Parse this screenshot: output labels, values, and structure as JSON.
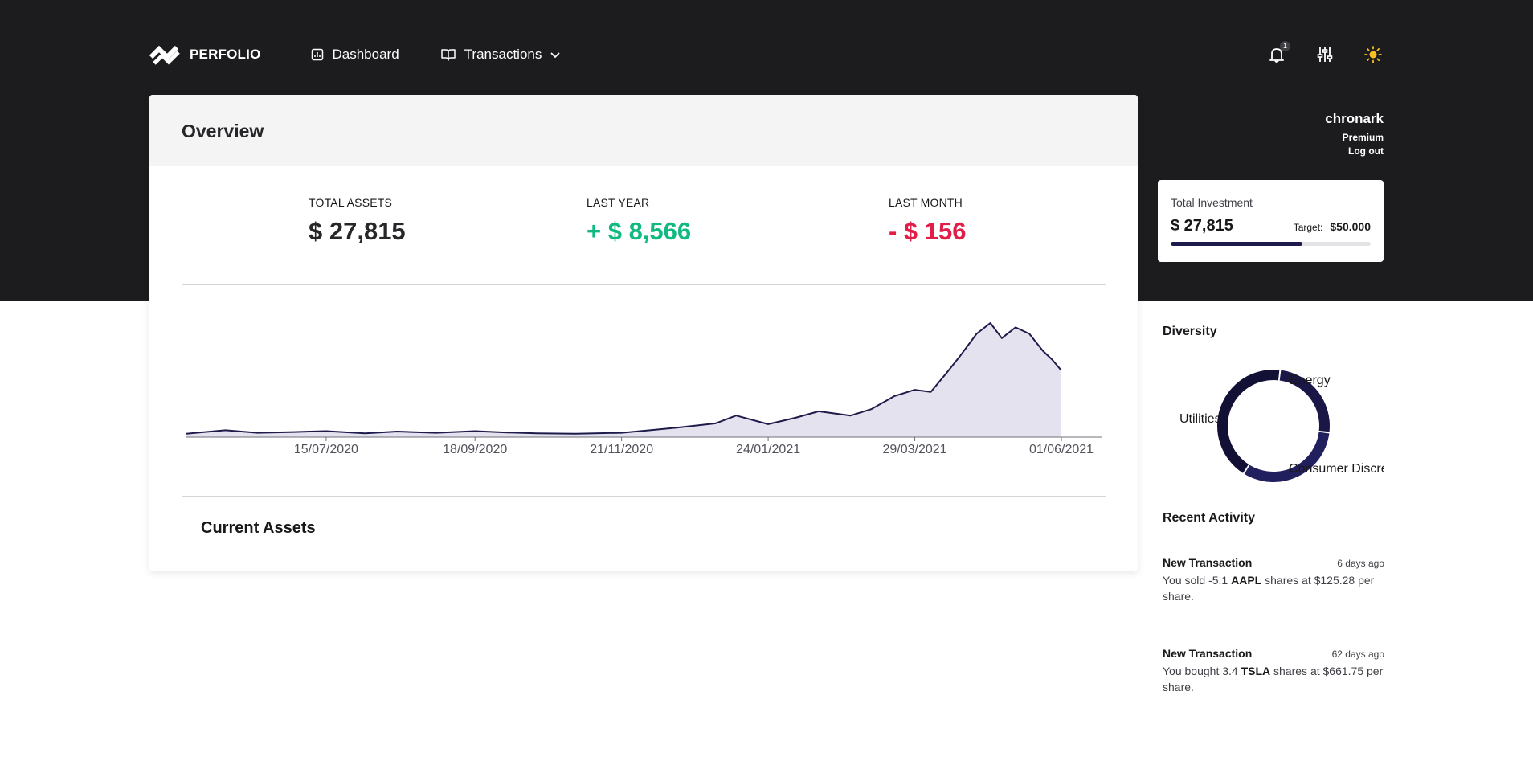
{
  "brand": {
    "name": "PERFOLIO"
  },
  "nav": {
    "items": [
      {
        "label": "Dashboard",
        "icon": "chart-icon"
      },
      {
        "label": "Transactions",
        "icon": "book-icon"
      }
    ],
    "notification_count": "1"
  },
  "user": {
    "name": "chronark",
    "plan": "Premium",
    "logout_label": "Log out"
  },
  "investment": {
    "label": "Total Investment",
    "amount": "$ 27,815",
    "target_label": "Target:",
    "target_value": "$50.000",
    "progress_fraction": 0.66,
    "bar_color": "#1e1b4b"
  },
  "overview": {
    "title": "Overview",
    "stats": [
      {
        "label": "TOTAL ASSETS",
        "value": "$ 27,815",
        "color": "#27272a"
      },
      {
        "label": "LAST YEAR",
        "value": "+ $ 8,566",
        "color": "#10b981"
      },
      {
        "label": "LAST MONTH",
        "value": "- $ 156",
        "color": "#e11d48"
      }
    ],
    "current_assets_title": "Current Assets"
  },
  "chart_data": {
    "type": "area",
    "title": "",
    "xlabel": "",
    "ylabel": "",
    "x_ticks": [
      "15/07/2020",
      "18/09/2020",
      "21/11/2020",
      "24/01/2021",
      "29/03/2021",
      "01/06/2021"
    ],
    "y_axis_shown": false,
    "grid": false,
    "line_color": "#1e1b4b",
    "fill_color": "#e4e2ee",
    "x": [
      "2020-05-15",
      "2020-06-01",
      "2020-06-15",
      "2020-07-01",
      "2020-07-15",
      "2020-08-01",
      "2020-08-15",
      "2020-09-01",
      "2020-09-18",
      "2020-10-01",
      "2020-10-15",
      "2020-11-01",
      "2020-11-21",
      "2020-12-01",
      "2020-12-15",
      "2021-01-01",
      "2021-01-10",
      "2021-01-24",
      "2021-02-05",
      "2021-02-15",
      "2021-03-01",
      "2021-03-10",
      "2021-03-20",
      "2021-03-29",
      "2021-04-05",
      "2021-04-12",
      "2021-04-18",
      "2021-04-25",
      "2021-05-01",
      "2021-05-06",
      "2021-05-12",
      "2021-05-18",
      "2021-05-24",
      "2021-05-28",
      "2021-06-01"
    ],
    "values": [
      800,
      1600,
      1000,
      1200,
      1400,
      900,
      1300,
      1000,
      1400,
      1100,
      900,
      800,
      1000,
      1500,
      2200,
      3200,
      5000,
      3000,
      4500,
      6000,
      5000,
      6500,
      9500,
      11000,
      10500,
      15000,
      19000,
      24000,
      26500,
      23000,
      25500,
      24000,
      20000,
      18000,
      15500
    ]
  },
  "sidebar": {
    "diversity": {
      "title": "Diversity",
      "slices": [
        {
          "label": "Energy",
          "value": 25
        },
        {
          "label": "Consumer Discretionary",
          "value": 32
        },
        {
          "label": "Utilities",
          "value": 43
        }
      ],
      "colors": [
        "#1a1747",
        "#221f5e",
        "#131035"
      ]
    },
    "recent_title": "Recent Activity",
    "activity": [
      {
        "title": "New Transaction",
        "time": "6 days ago",
        "pre": "You sold -5.1 ",
        "ticker": "AAPL",
        "post": " shares at $125.28 per share."
      },
      {
        "title": "New Transaction",
        "time": "62 days ago",
        "pre": "You bought 3.4 ",
        "ticker": "TSLA",
        "post": " shares at $661.75 per share."
      }
    ]
  }
}
